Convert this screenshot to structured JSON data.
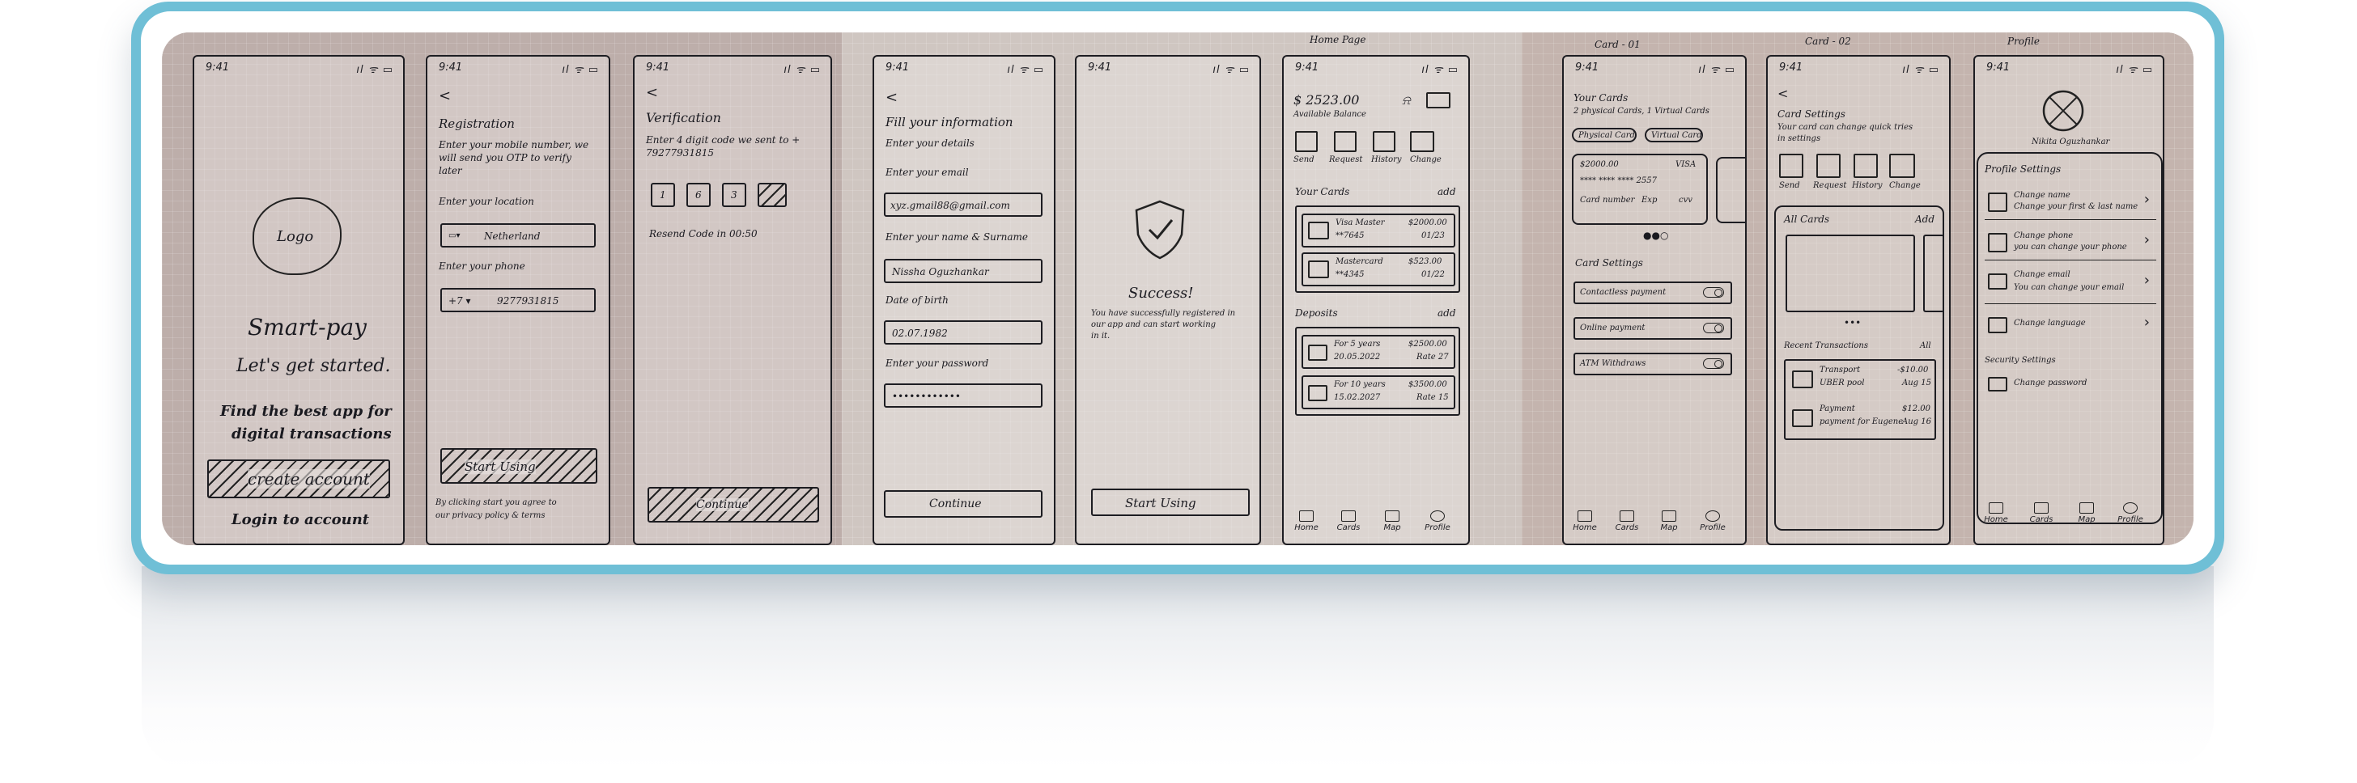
{
  "status_time": "9:41",
  "status_icons": "ıl ᯤ ▭",
  "captions": {
    "home_page": "Home Page",
    "card_01": "Card - 01",
    "card_02": "Card - 02",
    "profile": "Profile"
  },
  "screen1": {
    "logo": "Logo",
    "app_name": "Smart-pay",
    "tagline": "Let's get started.",
    "subtitle_line1": "Find the best app for",
    "subtitle_line2": "digital transactions",
    "create_account": "create account",
    "login": "Login to account"
  },
  "screen2": {
    "back": "<",
    "title": "Registration",
    "desc_line1": "Enter your mobile number, we",
    "desc_line2": "will send you OTP to verify",
    "desc_line3": "later",
    "location_label": "Enter your location",
    "location_value": "Netherland",
    "phone_label": "Enter your phone",
    "phone_code": "+7 ▾",
    "phone_value": "9277931815",
    "start_button": "Start Using",
    "terms_line1": "By clicking start you agree to",
    "terms_line2": "our privacy policy & terms"
  },
  "screen3": {
    "back": "<",
    "title": "Verification",
    "desc_line1": "Enter 4 digit code we sent to +",
    "desc_line2": "79277931815",
    "digits": [
      "1",
      "6",
      "3",
      ""
    ],
    "resend": "Resend Code in 00:50",
    "continue_button": "Continue"
  },
  "screen4": {
    "back": "<",
    "title": "Fill your information",
    "subtitle": "Enter your details",
    "email_label": "Enter your email",
    "email_value": "xyz.gmail88@gmail.com",
    "name_label": "Enter your name & Surname",
    "name_value": "Nissha Oguzhankar",
    "dob_label": "Date of birth",
    "dob_value": "02.07.1982",
    "password_label": "Enter your password",
    "password_value": "••••••••••••",
    "continue_button": "Continue"
  },
  "screen5": {
    "title": "Success!",
    "msg_line1": "You have successfully registered in",
    "msg_line2": "our app and can start working",
    "msg_line3": "in it.",
    "start_button": "Start Using"
  },
  "screen6": {
    "balance": "$ 2523.00",
    "balance_label": "Available Balance",
    "actions": [
      "Send",
      "Request",
      "History",
      "Change"
    ],
    "cards_title": "Your Cards",
    "cards_add": "add",
    "cards": [
      {
        "name": "Visa Master",
        "number": "**7645",
        "amount": "$2000.00",
        "exp": "01/23"
      },
      {
        "name": "Mastercard",
        "number": "**4345",
        "amount": "$523.00",
        "exp": "01/22"
      }
    ],
    "deposits_title": "Deposits",
    "deposits_add": "add",
    "deposits": [
      {
        "name": "For 5 years",
        "date": "20.05.2022",
        "amount": "$2500.00",
        "rate": "Rate 27"
      },
      {
        "name": "For 10 years",
        "date": "15.02.2027",
        "amount": "$3500.00",
        "rate": "Rate 15"
      }
    ],
    "nav": [
      "Home",
      "Cards",
      "Map",
      "Profile"
    ]
  },
  "screen7": {
    "title": "Your Cards",
    "subtitle": "2 physical Cards, 1 Virtual Cards",
    "tab_physical": "Physical Card",
    "tab_virtual": "Virtual Card",
    "card_amount": "$2000.00",
    "card_brand": "VISA",
    "card_number": "**** **** **** 2557",
    "card_holder": "Card number",
    "card_exp": "Exp",
    "card_cvv": "cvv",
    "settings_title": "Card Settings",
    "settings": [
      "Contactless payment",
      "Online payment",
      "ATM Withdraws"
    ],
    "nav": [
      "Home",
      "Cards",
      "Map",
      "Profile"
    ]
  },
  "screen8": {
    "back": "<",
    "title": "Card Settings",
    "desc_line1": "Your card can change quick tries",
    "desc_line2": "in settings",
    "actions": [
      "Send",
      "Request",
      "History",
      "Change"
    ],
    "all_cards": "All Cards",
    "all_cards_add": "Add",
    "recent_title": "Recent Transactions",
    "recent_all": "All",
    "transactions": [
      {
        "name": "Transport",
        "sub": "UBER pool",
        "amount": "-$10.00",
        "date": "Aug 15"
      },
      {
        "name": "Payment",
        "sub": "payment for Eugene",
        "amount": "$12.00",
        "date": "Aug 16"
      }
    ]
  },
  "screen9": {
    "user_name": "Nikita Oguzhankar",
    "profile_settings": "Profile Settings",
    "items": [
      {
        "title": "Change name",
        "sub": "Change your first & last name"
      },
      {
        "title": "Change phone",
        "sub": "you can change your phone"
      },
      {
        "title": "Change email",
        "sub": "You can change your email"
      },
      {
        "title": "Change language",
        "sub": ""
      }
    ],
    "security_settings": "Security Settings",
    "change_password": "Change password",
    "nav": [
      "Home",
      "Cards",
      "Map",
      "Profile"
    ]
  }
}
